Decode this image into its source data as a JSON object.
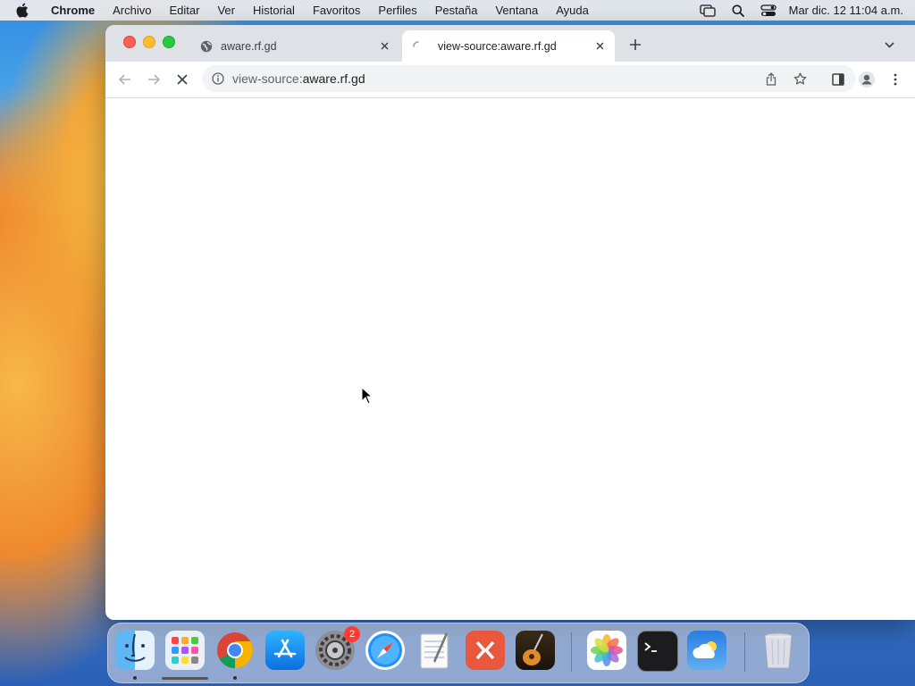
{
  "menubar": {
    "app_name": "Chrome",
    "items": [
      "Archivo",
      "Editar",
      "Ver",
      "Historial",
      "Favoritos",
      "Perfiles",
      "Pestaña",
      "Ventana",
      "Ayuda"
    ],
    "clock": "Mar dic. 12  11:04 a.m."
  },
  "browser": {
    "tabs": [
      {
        "title": "aware.rf.gd",
        "favicon": "globe-icon",
        "active": false
      },
      {
        "title": "view-source:aware.rf.gd",
        "favicon": "loading-spinner-icon",
        "active": true
      }
    ],
    "address": {
      "scheme": "view-source:",
      "host": "aware.rf.gd"
    }
  },
  "dock": {
    "apps": [
      "Finder",
      "Launchpad",
      "Google Chrome",
      "App Store",
      "System Preferences",
      "Safari",
      "TextEdit",
      "Remote Desktop",
      "GarageBand",
      "Photos",
      "Terminal",
      "Weather",
      "Trash"
    ],
    "badge_system_preferences": "2"
  }
}
